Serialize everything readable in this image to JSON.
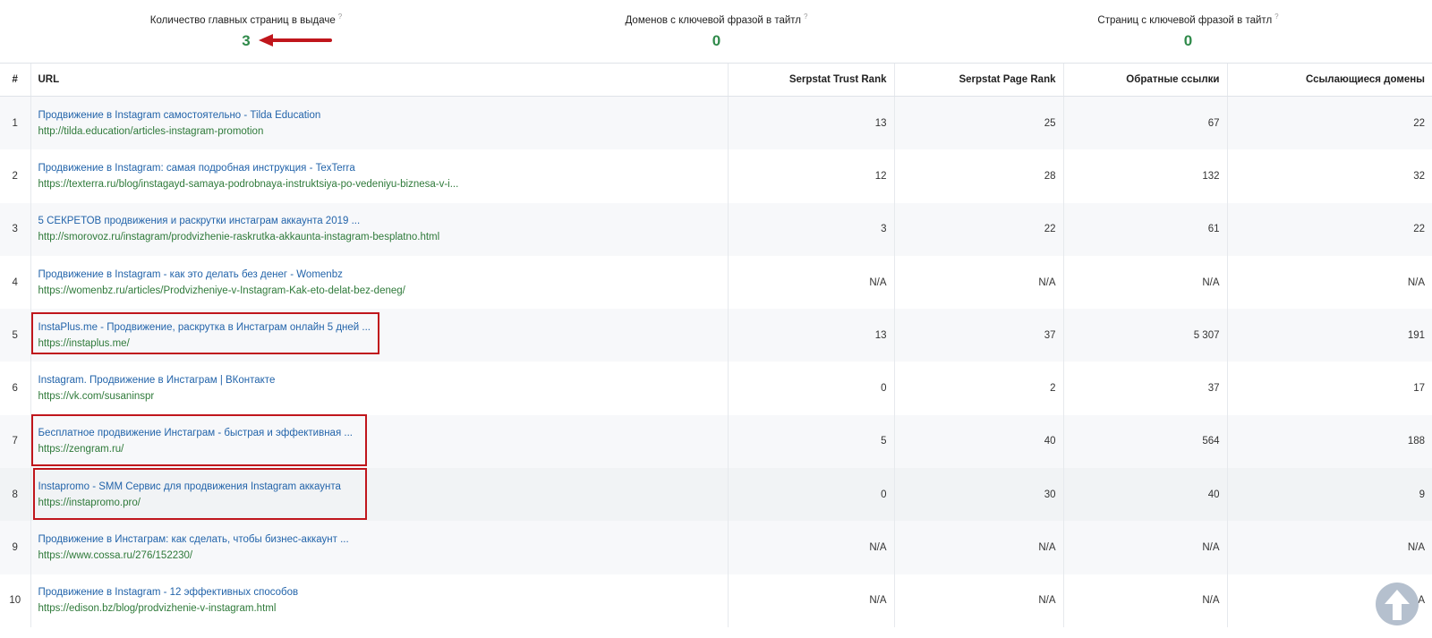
{
  "summary": {
    "main_pages": {
      "label": "Количество главных страниц в выдаче",
      "help": "?",
      "value": "3"
    },
    "domains_title": {
      "label": "Доменов с ключевой фразой в тайтл",
      "help": "?",
      "value": "0"
    },
    "pages_title": {
      "label": "Страниц с ключевой фразой в тайтл",
      "help": "?",
      "value": "0"
    }
  },
  "table": {
    "headers": {
      "num": "#",
      "url": "URL",
      "trust": "Serpstat Trust Rank",
      "page_rank": "Serpstat Page Rank",
      "backlinks": "Обратные ссылки",
      "ref_domains": "Ссылающиеся домены"
    },
    "rows": [
      {
        "num": "1",
        "title": "Продвижение в Instagram самостоятельно - Tilda Education",
        "url": "http://tilda.education/articles-instagram-promotion",
        "trust": "13",
        "page_rank": "25",
        "backlinks": "67",
        "ref_domains": "22"
      },
      {
        "num": "2",
        "title": "Продвижение в Instagram: самая подробная инструкция - TexTerra",
        "url": "https://texterra.ru/blog/instagayd-samaya-podrobnaya-instruktsiya-po-vedeniyu-biznesa-v-i...",
        "trust": "12",
        "page_rank": "28",
        "backlinks": "132",
        "ref_domains": "32"
      },
      {
        "num": "3",
        "title": "5 СЕКРЕТОВ продвижения и раскрутки инстаграм аккаунта 2019 ...",
        "url": "http://smorovoz.ru/instagram/prodvizhenie-raskrutka-akkaunta-instagram-besplatno.html",
        "trust": "3",
        "page_rank": "22",
        "backlinks": "61",
        "ref_domains": "22"
      },
      {
        "num": "4",
        "title": "Продвижение в Instagram - как это делать без денег - Womenbz",
        "url": "https://womenbz.ru/articles/Prodvizheniye-v-Instagram-Kak-eto-delat-bez-deneg/",
        "trust": "N/A",
        "page_rank": "N/A",
        "backlinks": "N/A",
        "ref_domains": "N/A"
      },
      {
        "num": "5",
        "title": "InstaPlus.me - Продвижение, раскрутка в Инстаграм онлайн 5 дней ...",
        "url": "https://instaplus.me/",
        "trust": "13",
        "page_rank": "37",
        "backlinks": "5 307",
        "ref_domains": "191"
      },
      {
        "num": "6",
        "title": "Instagram. Продвижение в Инстаграм | ВКонтакте",
        "url": "https://vk.com/susaninspr",
        "trust": "0",
        "page_rank": "2",
        "backlinks": "37",
        "ref_domains": "17"
      },
      {
        "num": "7",
        "title": "Бесплатное продвижение Инстаграм - быстрая и эффективная ...",
        "url": "https://zengram.ru/",
        "trust": "5",
        "page_rank": "40",
        "backlinks": "564",
        "ref_domains": "188"
      },
      {
        "num": "8",
        "title": "Instapromo - SMM Сервис для продвижения Instagram аккаунта",
        "url": "https://instapromo.pro/",
        "trust": "0",
        "page_rank": "30",
        "backlinks": "40",
        "ref_domains": "9"
      },
      {
        "num": "9",
        "title": "Продвижение в Инстаграм: как сделать, чтобы бизнес-аккаунт ...",
        "url": "https://www.cossa.ru/276/152230/",
        "trust": "N/A",
        "page_rank": "N/A",
        "backlinks": "N/A",
        "ref_domains": "N/A"
      },
      {
        "num": "10",
        "title": "Продвижение в Instagram - 12 эффективных способов",
        "url": "https://edison.bz/blog/prodvizhenie-v-instagram.html",
        "trust": "N/A",
        "page_rank": "N/A",
        "backlinks": "N/A",
        "ref_domains": "A"
      }
    ]
  },
  "colors": {
    "value_green": "#2f8a4a",
    "title_link": "#2364aa",
    "url_link": "#2f7a3a",
    "highlight": "#c0161c"
  },
  "icons": {
    "arrow": "red-arrow-left-icon",
    "scroll_top": "arrow-up-icon"
  }
}
